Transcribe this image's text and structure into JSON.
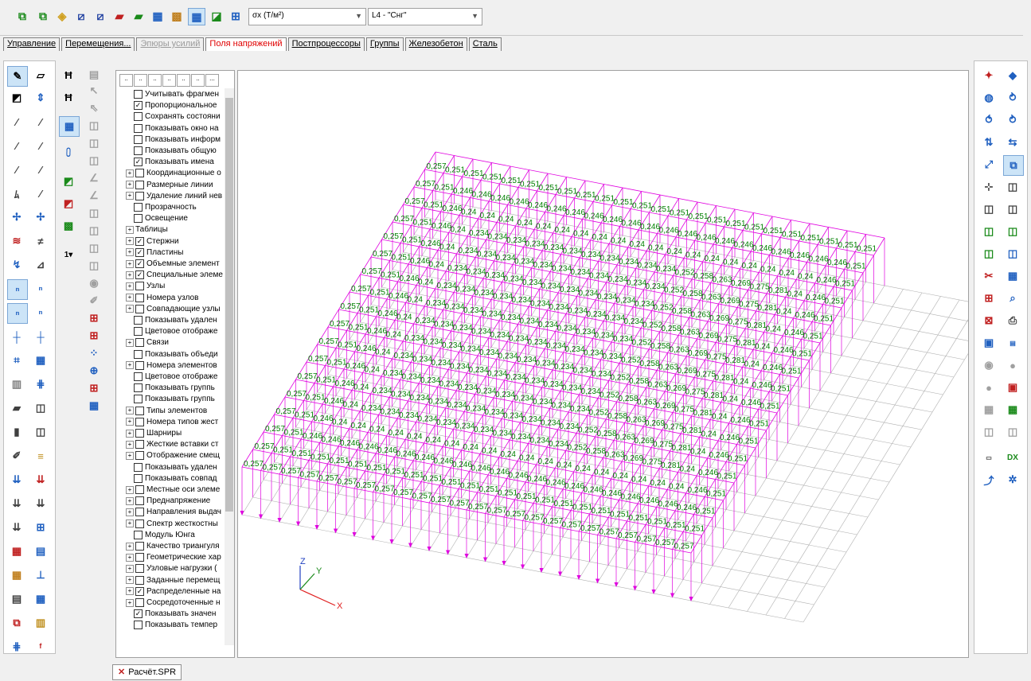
{
  "toolbar": {
    "stress_selector": "σx (Т/м²)",
    "load_selector": "L4 - \"Снг\""
  },
  "tabs": [
    {
      "label": "Управление",
      "state": "normal"
    },
    {
      "label": "Перемещения...",
      "state": "normal"
    },
    {
      "label": "Эпюры усилий",
      "state": "disabled"
    },
    {
      "label": "Поля напряжений",
      "state": "active"
    },
    {
      "label": "Постпроцессоры",
      "state": "normal"
    },
    {
      "label": "Группы",
      "state": "normal"
    },
    {
      "label": "Железобетон",
      "state": "normal"
    },
    {
      "label": "Сталь",
      "state": "normal"
    }
  ],
  "tree": {
    "items": [
      {
        "label": "Учитывать фрагмен",
        "expand": false,
        "checked": false
      },
      {
        "label": "Пропорциональное",
        "expand": false,
        "checked": true
      },
      {
        "label": "Сохранять состояни",
        "expand": false,
        "checked": false
      },
      {
        "label": "Показывать окно на",
        "expand": false,
        "checked": false
      },
      {
        "label": "Показывать информ",
        "expand": false,
        "checked": false
      },
      {
        "label": "Показывать общую",
        "expand": false,
        "checked": false
      },
      {
        "label": "Показывать имена",
        "expand": false,
        "checked": true
      },
      {
        "label": "Координационные о",
        "expand": true,
        "checked": false
      },
      {
        "label": "Размерные линии",
        "expand": true,
        "checked": false
      },
      {
        "label": "Удаление линий нев",
        "expand": true,
        "checked": false
      },
      {
        "label": "Прозрачность",
        "expand": false,
        "checked": false
      },
      {
        "label": "Освещение",
        "expand": false,
        "checked": false
      },
      {
        "label": "Таблицы",
        "expand": true,
        "checked": null
      },
      {
        "label": "Стержни",
        "expand": true,
        "checked": true
      },
      {
        "label": "Пластины",
        "expand": true,
        "checked": true
      },
      {
        "label": "Объемные элемент",
        "expand": true,
        "checked": true
      },
      {
        "label": "Специальные элеме",
        "expand": true,
        "checked": true
      },
      {
        "label": "Узлы",
        "expand": true,
        "checked": false
      },
      {
        "label": "Номера узлов",
        "expand": true,
        "checked": false
      },
      {
        "label": "Совпадающие узлы",
        "expand": true,
        "checked": false
      },
      {
        "label": "Показывать удален",
        "expand": false,
        "checked": false
      },
      {
        "label": "Цветовое отображе",
        "expand": false,
        "checked": false
      },
      {
        "label": "Связи",
        "expand": true,
        "checked": false
      },
      {
        "label": "Показывать объеди",
        "expand": false,
        "checked": false
      },
      {
        "label": "Номера элементов",
        "expand": true,
        "checked": false
      },
      {
        "label": "Цветовое отображе",
        "expand": false,
        "checked": false
      },
      {
        "label": "Показывать группь",
        "expand": false,
        "checked": false
      },
      {
        "label": "Показывать группь",
        "expand": false,
        "checked": false
      },
      {
        "label": "Типы элементов",
        "expand": true,
        "checked": false
      },
      {
        "label": "Номера типов жест",
        "expand": true,
        "checked": false
      },
      {
        "label": "Шарниры",
        "expand": true,
        "checked": false
      },
      {
        "label": "Жесткие вставки ст",
        "expand": true,
        "checked": false
      },
      {
        "label": "Отображение смещ",
        "expand": true,
        "checked": false
      },
      {
        "label": "Показывать удален",
        "expand": false,
        "checked": false
      },
      {
        "label": "Показывать совпад",
        "expand": false,
        "checked": false
      },
      {
        "label": "Местные оси элеме",
        "expand": true,
        "checked": false
      },
      {
        "label": "Преднапряжение",
        "expand": true,
        "checked": false
      },
      {
        "label": "Направления выдач",
        "expand": true,
        "checked": false
      },
      {
        "label": "Спектр жесткостны",
        "expand": true,
        "checked": false
      },
      {
        "label": "Модуль Юнга",
        "expand": false,
        "checked": false
      },
      {
        "label": "Качество триангуля",
        "expand": true,
        "checked": false
      },
      {
        "label": "Геометрические хар",
        "expand": true,
        "checked": false
      },
      {
        "label": "Узловые нагрузки (",
        "expand": true,
        "checked": false
      },
      {
        "label": "Заданные перемещ",
        "expand": true,
        "checked": false
      },
      {
        "label": "Распределенные на",
        "expand": true,
        "checked": true
      },
      {
        "label": "Сосредоточенные н",
        "expand": true,
        "checked": false
      },
      {
        "label": "Показывать значен",
        "expand": false,
        "checked": true
      },
      {
        "label": "Показывать темпер",
        "expand": false,
        "checked": false
      }
    ]
  },
  "axes": {
    "x": "X",
    "y": "Y",
    "z": "Z"
  },
  "value_labels": [
    "0,257",
    "0,251",
    "0,246",
    "0,24",
    "0,234",
    "0,252",
    "0,258",
    "0,263",
    "0,269",
    "0,275",
    "0,281",
    "0,287",
    "0,254",
    "0,247",
    "0,244"
  ],
  "file_tab": "Расчёт.SPR",
  "colors": {
    "load": "#e000e0",
    "values": "#008000",
    "grid": "#b0b0b0",
    "active_tab": "#e00000"
  }
}
